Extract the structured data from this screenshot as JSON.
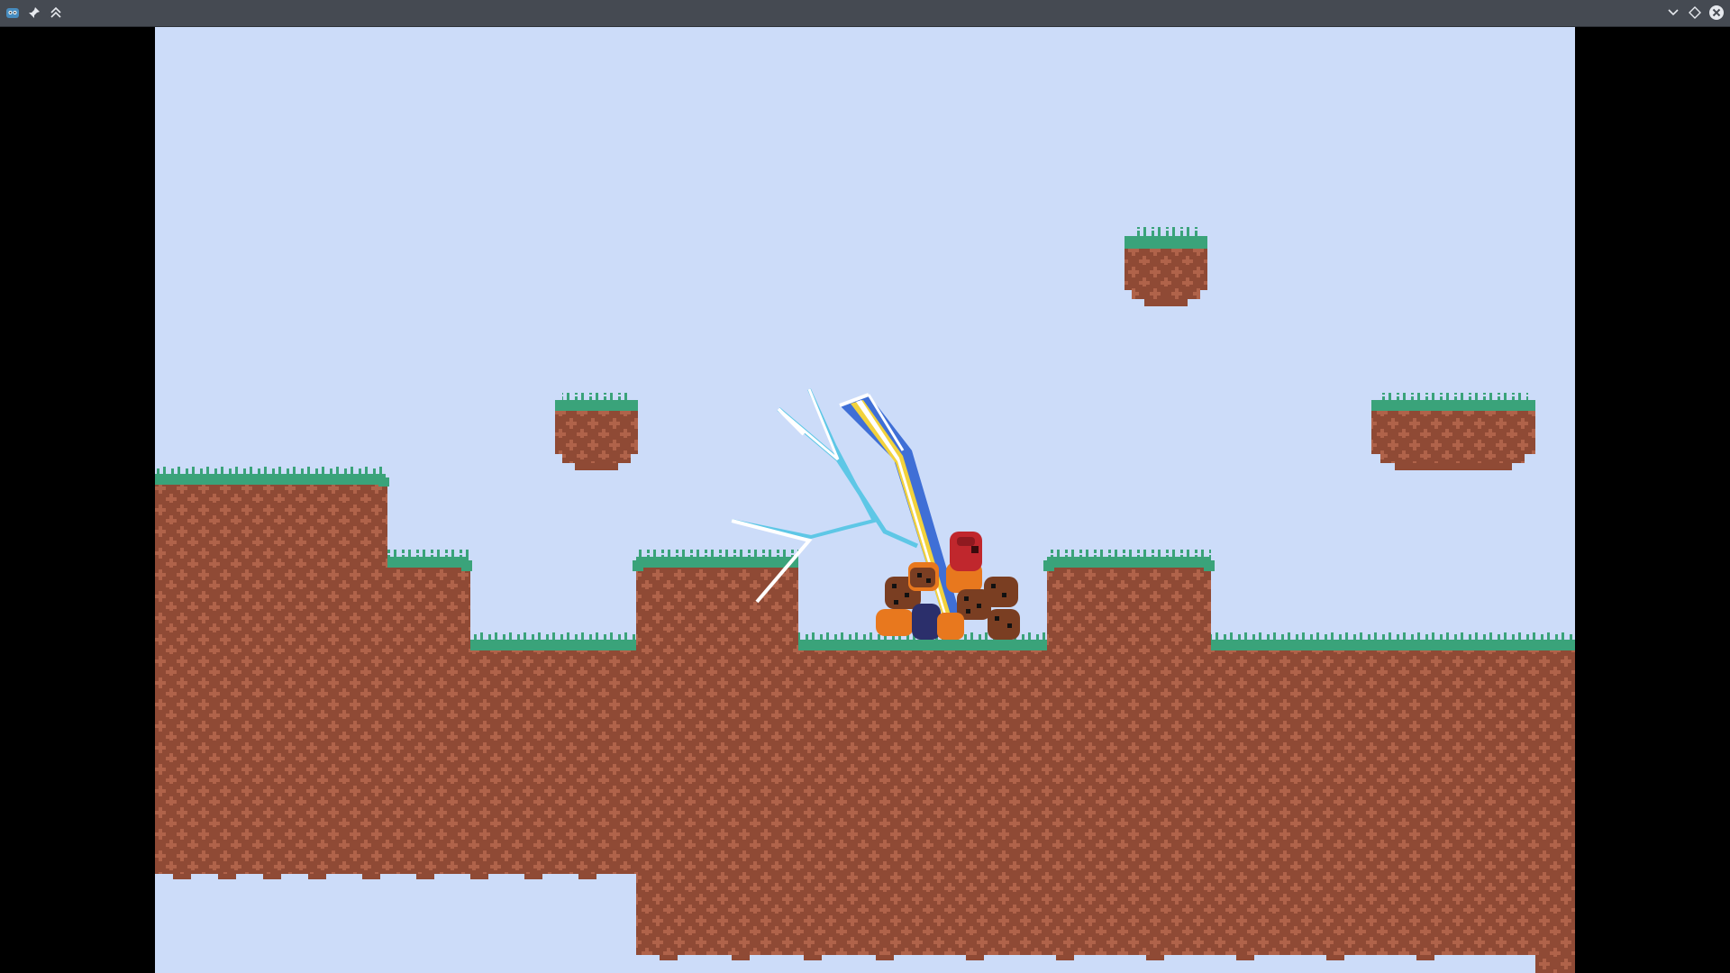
{
  "window": {
    "title": "",
    "icons": {
      "app": "godot-icon",
      "pin": "pin-icon",
      "keep_above": "keep-above-icon",
      "minimize": "chevron-down-icon",
      "maximize": "diamond-icon",
      "close": "close-icon"
    }
  },
  "game": {
    "colors": {
      "sky": "#ccdcf9",
      "dirt": "#8f4a35",
      "dirt_pattern": "#b0634a",
      "grass": "#3aa37a",
      "grass_top": "#2f8a66",
      "lightning_white": "#ffffff",
      "lightning_cyan": "#5ec7e6",
      "beam_blue": "#3f6fd6",
      "beam_yellow": "#f2d23c",
      "player_red": "#c0272d",
      "enemy_orange": "#e8781e",
      "enemy_brown": "#7a3e22",
      "enemy_dark_blue": "#2b2f6b"
    },
    "entities": [
      {
        "type": "player",
        "color": "player_red"
      },
      {
        "type": "lightning-attack"
      },
      {
        "type": "enemy-pile",
        "count": 9
      }
    ]
  }
}
